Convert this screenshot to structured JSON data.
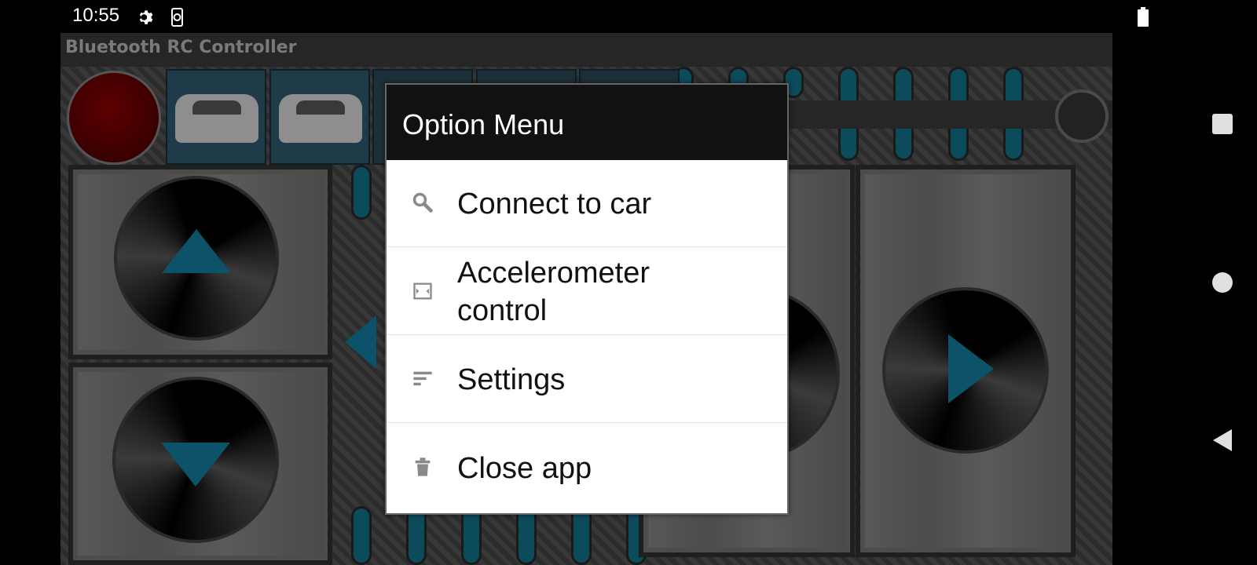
{
  "status_bar": {
    "time": "10:55",
    "icons": [
      "gear-icon",
      "phone-sync-icon",
      "battery-icon"
    ]
  },
  "nav_bar": {
    "buttons": [
      "recents-button",
      "home-button",
      "back-button"
    ]
  },
  "app": {
    "title": "Bluetooth RC Controller",
    "colors": {
      "accent": "#0c5369",
      "red_button": "#5e0000"
    }
  },
  "dialog": {
    "title": "Option Menu",
    "items": [
      {
        "label": "Connect to car",
        "icon": "search-icon"
      },
      {
        "label": "Accelerometer\ncontrol",
        "icon": "rotate-icon"
      },
      {
        "label": "Settings",
        "icon": "sort-icon"
      },
      {
        "label": "Close app",
        "icon": "trash-icon"
      }
    ]
  }
}
